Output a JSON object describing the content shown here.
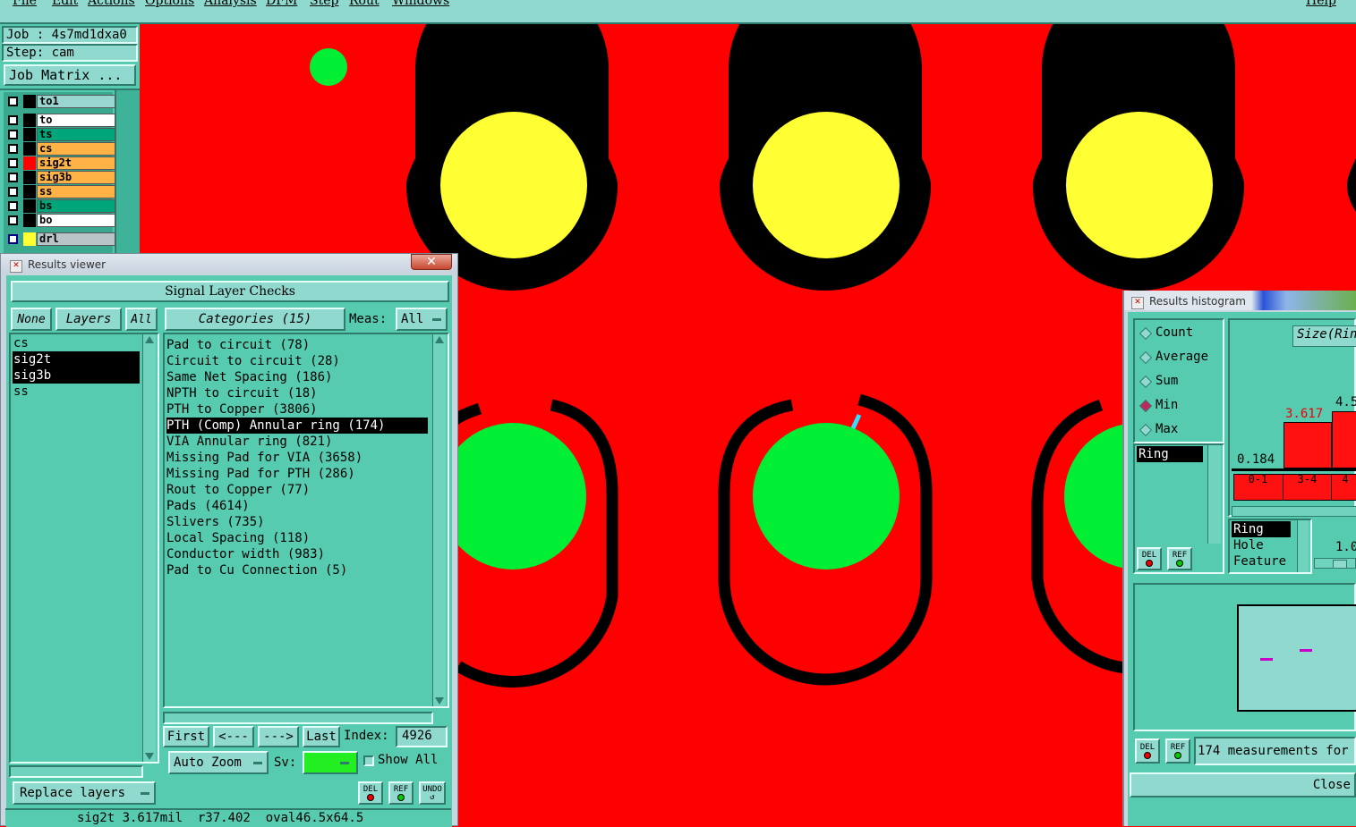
{
  "menubar": {
    "items": [
      "File",
      "Edit",
      "Actions",
      "Options",
      "Analysis",
      "DFM",
      "Step",
      "Rout",
      "Windows"
    ],
    "help": "Help"
  },
  "job": {
    "job_label": "Job : 4s7md1dxa0",
    "step_label": "Step: cam",
    "matrix_button": "Job Matrix ..."
  },
  "layers": [
    {
      "name": "to1",
      "color": "#9ad6d0",
      "swatch": "#000000"
    },
    {
      "name": "to",
      "color": "#ffffff",
      "swatch": "#000000"
    },
    {
      "name": "ts",
      "color": "#00a67a",
      "swatch": "#000000"
    },
    {
      "name": "cs",
      "color": "#ffb347",
      "swatch": "#000000"
    },
    {
      "name": "sig2t",
      "color": "#ffb347",
      "swatch": "#ff0000"
    },
    {
      "name": "sig3b",
      "color": "#ffb347",
      "swatch": "#000000"
    },
    {
      "name": "ss",
      "color": "#ffb347",
      "swatch": "#000000"
    },
    {
      "name": "bs",
      "color": "#00a67a",
      "swatch": "#000000"
    },
    {
      "name": "bo",
      "color": "#ffffff",
      "swatch": "#000000"
    },
    {
      "name": "drl",
      "color": "#b8c4c8",
      "swatch": "#ffff33"
    }
  ],
  "results_viewer": {
    "title": "Results viewer",
    "header": "Signal Layer Checks",
    "none_btn": "None",
    "layers_btn": "Layers",
    "all_btn": "All",
    "categories_btn": "Categories (15)",
    "meas_label": "Meas:",
    "meas_value": "All",
    "layer_list": [
      "cs",
      "sig2t",
      "sig3b",
      "ss"
    ],
    "categories": [
      "Pad to circuit (78)",
      "Circuit to circuit (28)",
      "Same Net Spacing (186)",
      "NPTH to circuit (18)",
      "PTH to Copper (3806)",
      "PTH (Comp) Annular ring (174)",
      "VIA Annular ring (821)",
      "Missing Pad for VIA (3658)",
      "Missing Pad for PTH (286)",
      "Rout to Copper (77)",
      "Pads (4614)",
      "Slivers (735)",
      "Local Spacing (118)",
      "Conductor width (983)",
      "Pad to Cu Connection (5)"
    ],
    "first_btn": "First",
    "prev_btn": "<---",
    "next_btn": "--->",
    "last_btn": "Last",
    "index_label": "Index:",
    "index_value": "4926",
    "auto_zoom": "Auto Zoom",
    "sv_label": "Sv:",
    "show_all": "Show All",
    "replace_layers": "Replace layers",
    "del": "DEL",
    "ref": "REF",
    "undo": "UNDO",
    "status": "sig2t 3.617mil  r37.402  oval46.5x64.5"
  },
  "histogram": {
    "title": "Results histogram",
    "modes": [
      "Count",
      "Average",
      "Sum",
      "Min",
      "Max"
    ],
    "selected_mode": "Min",
    "size_label": "Size(Rin",
    "list": [
      "Ring"
    ],
    "min_value": "0.184",
    "bar_value_1": "3.617",
    "bar_value_2": "4.5",
    "bins": [
      "0-1",
      "3-4",
      "4"
    ],
    "types": [
      "Ring",
      "Hole",
      "Feature"
    ],
    "scale_value": "1.0",
    "measurements": "174 measurements for",
    "close_btn": "Close",
    "del": "DEL",
    "ref": "REF"
  }
}
